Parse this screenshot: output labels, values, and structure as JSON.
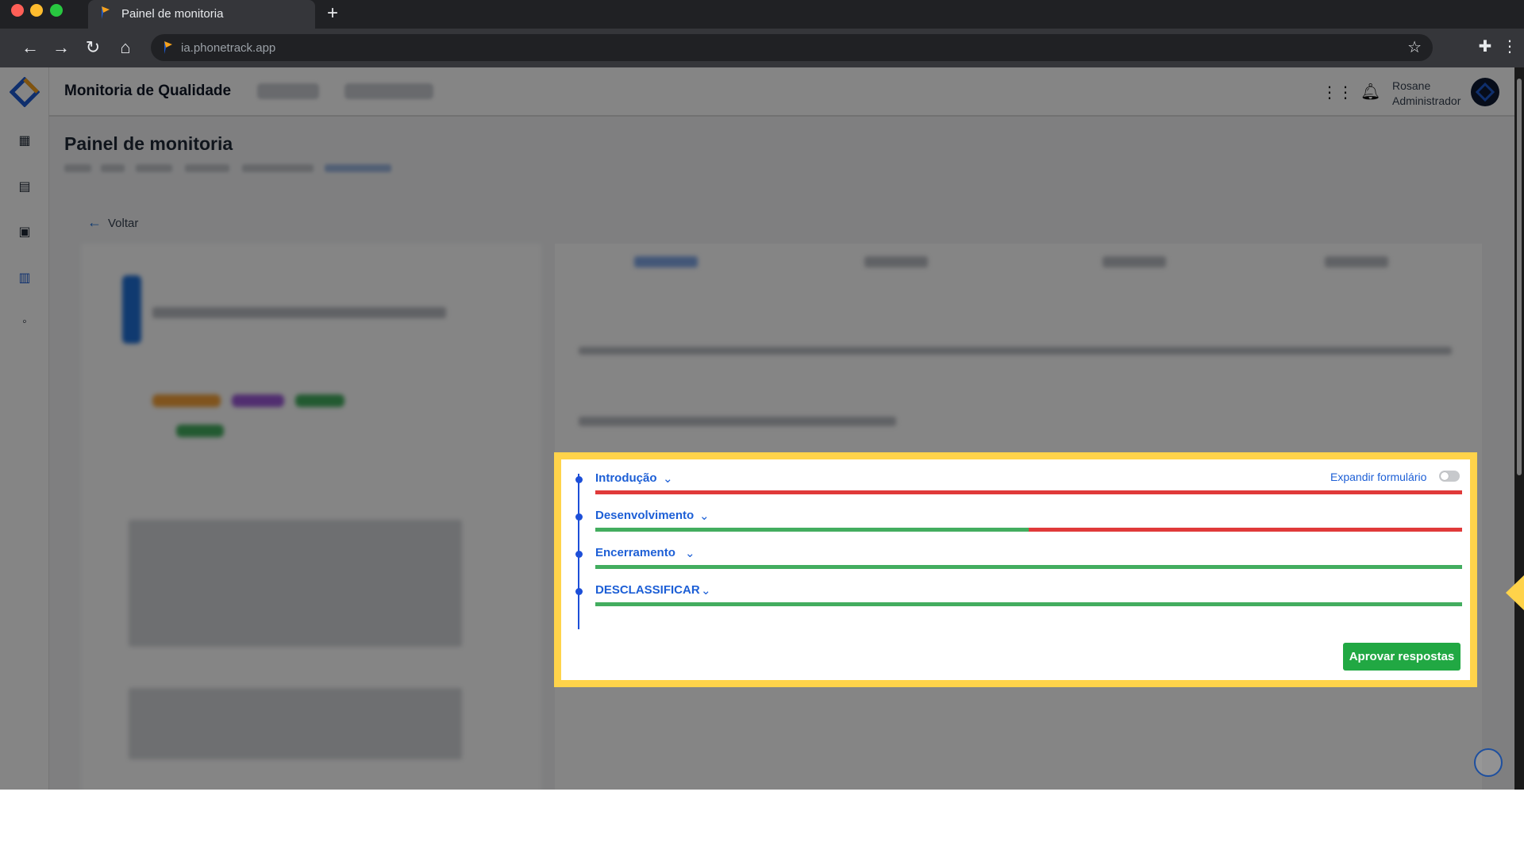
{
  "browser": {
    "tab_title": "Painel de monitoria",
    "new_tab_symbol": "+",
    "url": "ia.phonetrack.app",
    "icons": [
      "back-arrow-icon",
      "forward-arrow-icon",
      "reload-icon",
      "home-icon",
      "star-icon",
      "puzzle-icon",
      "kebab-menu-icon"
    ]
  },
  "header": {
    "app_title": "Monitoria de Qualidade",
    "user_name": "Rosane",
    "user_role": "Administrador",
    "icons": [
      "apps-grid-icon",
      "bell-icon"
    ]
  },
  "page": {
    "title": "Painel de monitoria",
    "back_label": "Voltar"
  },
  "form": {
    "expand_label": "Expandir formulário",
    "expand_checked": false,
    "sections": [
      {
        "label": "Introdução",
        "pass_fraction": 0.0
      },
      {
        "label": "Desenvolvimento",
        "pass_fraction": 0.5
      },
      {
        "label": "Encerramento",
        "pass_fraction": 1.0
      },
      {
        "label": "DESCLASSIFICAR",
        "pass_fraction": 1.0
      }
    ],
    "approve_label": "Aprovar respostas"
  },
  "colors": {
    "highlight": "#ffd34a",
    "pass": "#43ad5f",
    "fail": "#e03a3a",
    "primary": "#1d5fd6",
    "approve_button": "#21a843"
  }
}
